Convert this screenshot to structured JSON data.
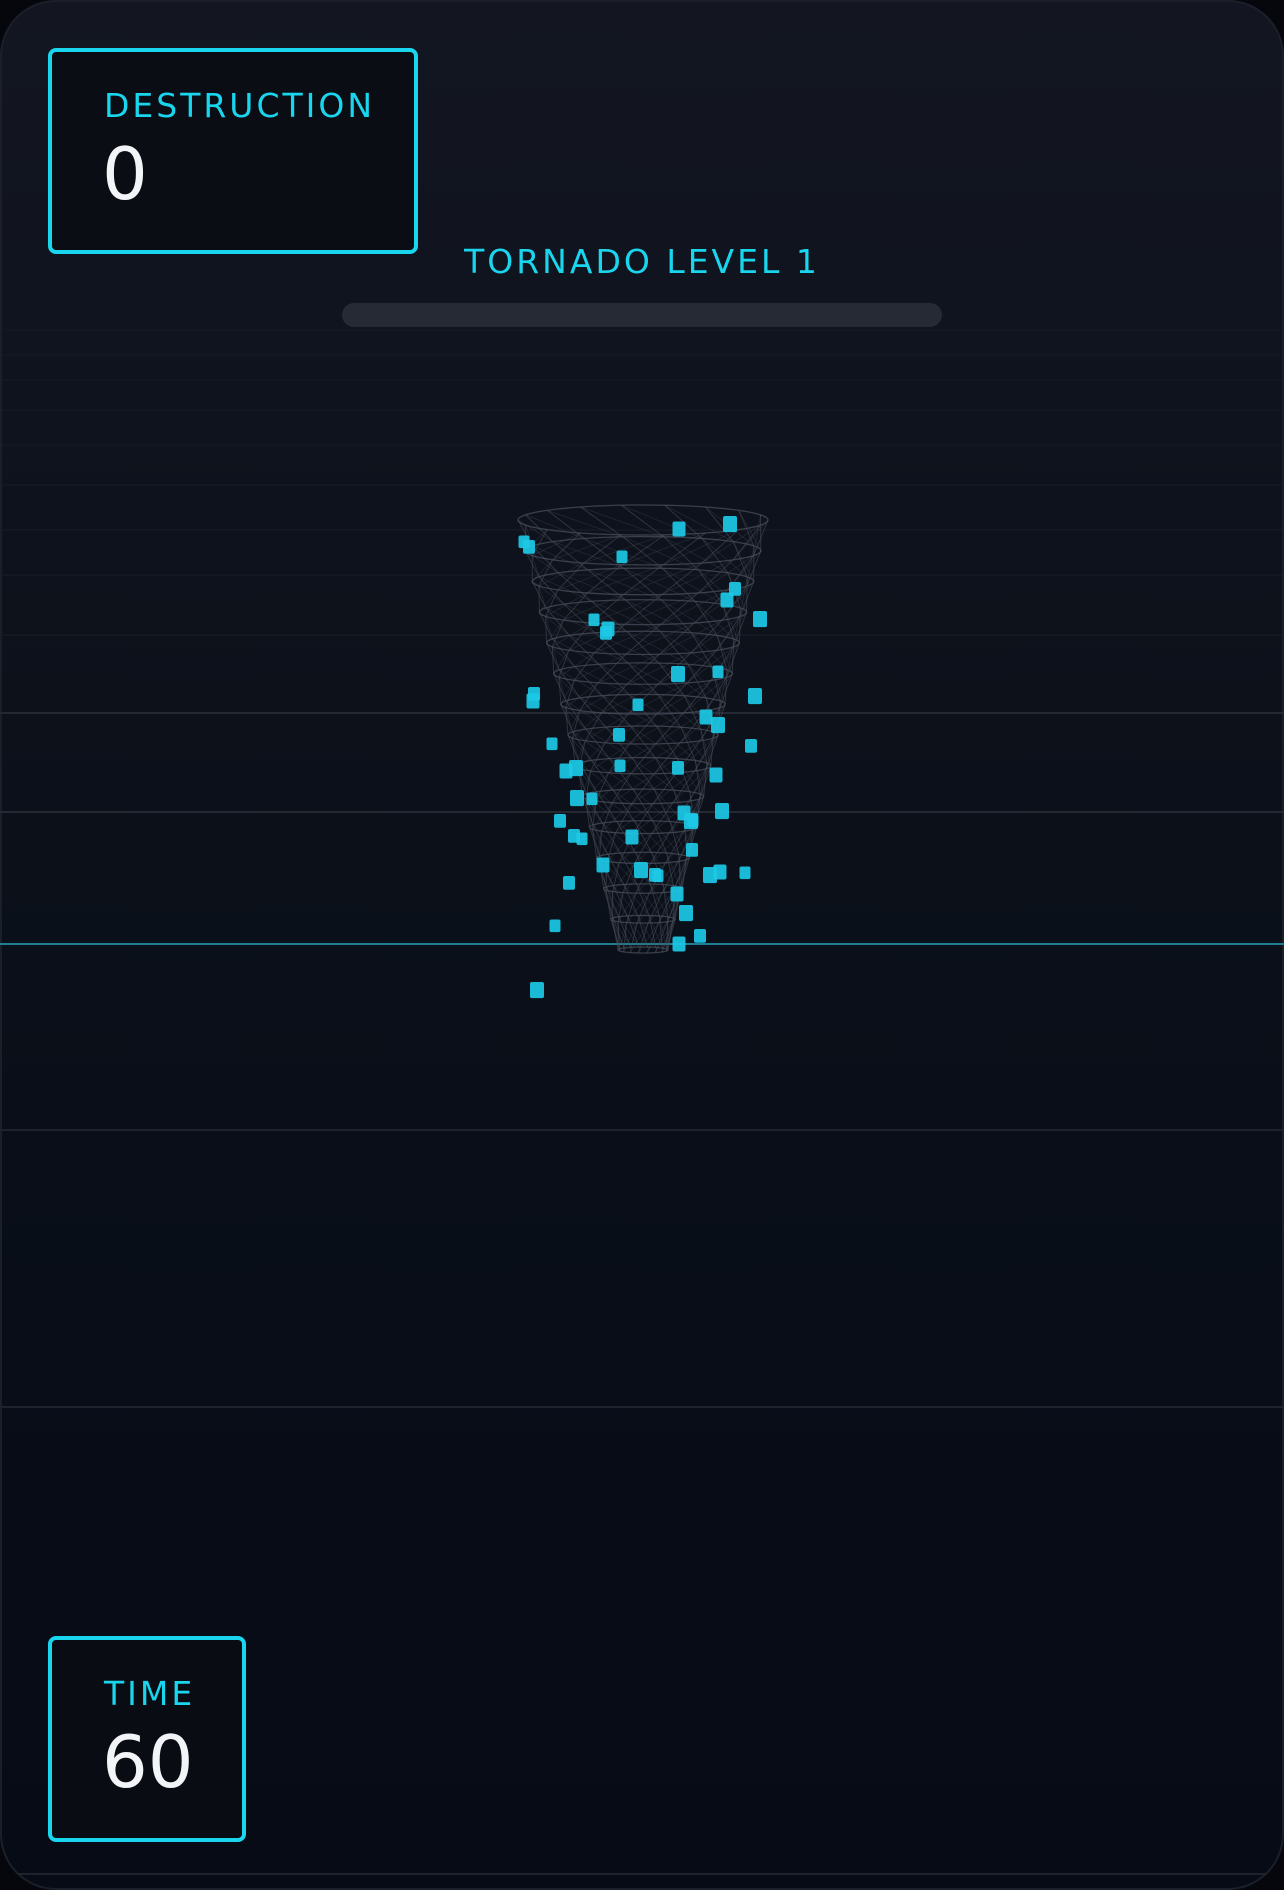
{
  "hud": {
    "destruction": {
      "label": "DESTRUCTION",
      "value": "0"
    },
    "time": {
      "label": "TIME",
      "value": "60"
    }
  },
  "tornado": {
    "level_label": "TORNADO LEVEL 1",
    "progress_fraction": 0
  },
  "colors": {
    "accent": "#19d6ee",
    "debris": "#1cc9e6",
    "tornado_mesh": "#4a4f5c",
    "value_text": "#f2f4f7"
  }
}
